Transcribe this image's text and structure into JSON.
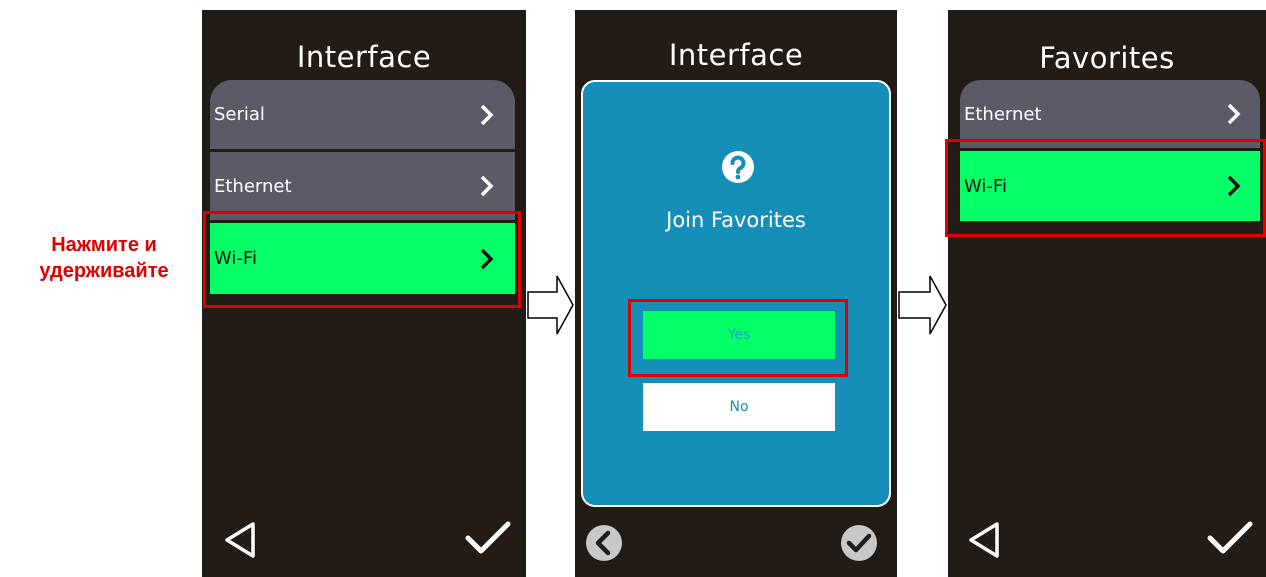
{
  "instruction": {
    "line1": "Нажмите и",
    "line2": "удерживайте"
  },
  "screen1": {
    "title": "Interface",
    "items": [
      {
        "label": "Serial"
      },
      {
        "label": "Ethernet"
      },
      {
        "label": "Wi-Fi"
      }
    ]
  },
  "screen2": {
    "title": "Interface",
    "dialog": {
      "title": "Join Favorites",
      "yes": "Yes",
      "no": "No"
    }
  },
  "screen3": {
    "title": "Favorites",
    "items": [
      {
        "label": "Ethernet"
      },
      {
        "label": "Wi-Fi"
      }
    ]
  },
  "colors": {
    "screen_bg": "#231b15",
    "item_grey": "#5b5b68",
    "highlight_green": "#05ff66",
    "dialog_blue": "#168fb8",
    "callout_red": "#e00000"
  },
  "icons": [
    "back-triangle-icon",
    "checkmark-icon",
    "chevron-right-icon",
    "question-icon",
    "back-circle-icon",
    "check-circle-icon",
    "flow-arrow-icon"
  ]
}
